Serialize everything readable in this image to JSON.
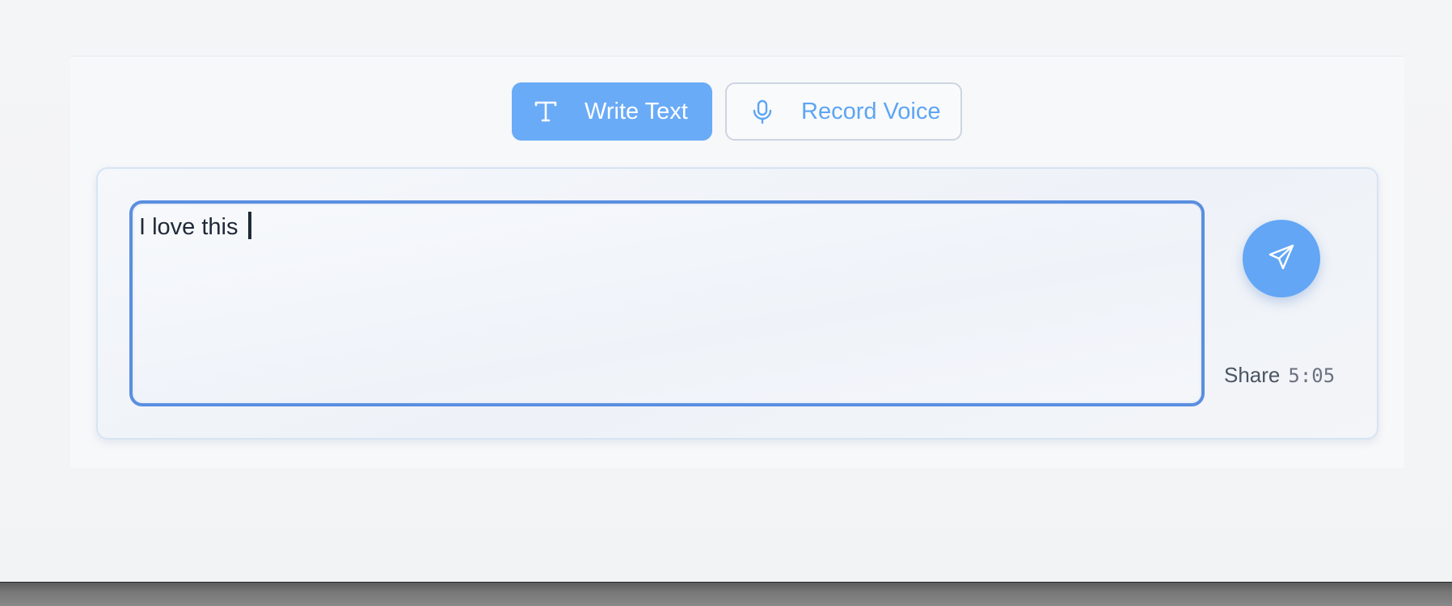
{
  "mode_tabs": {
    "write_label": "Write Text",
    "write_icon": "text-t-icon",
    "voice_label": "Record Voice",
    "voice_icon": "microphone-icon",
    "active": "Write Text"
  },
  "composer": {
    "text_value": "I love this ",
    "send_icon": "paper-plane-icon"
  },
  "share": {
    "label": "Share",
    "time": "5:05"
  },
  "colors": {
    "accent": "#6aabf7",
    "focus_border": "#5a8ee0",
    "text": "#1f2937"
  }
}
